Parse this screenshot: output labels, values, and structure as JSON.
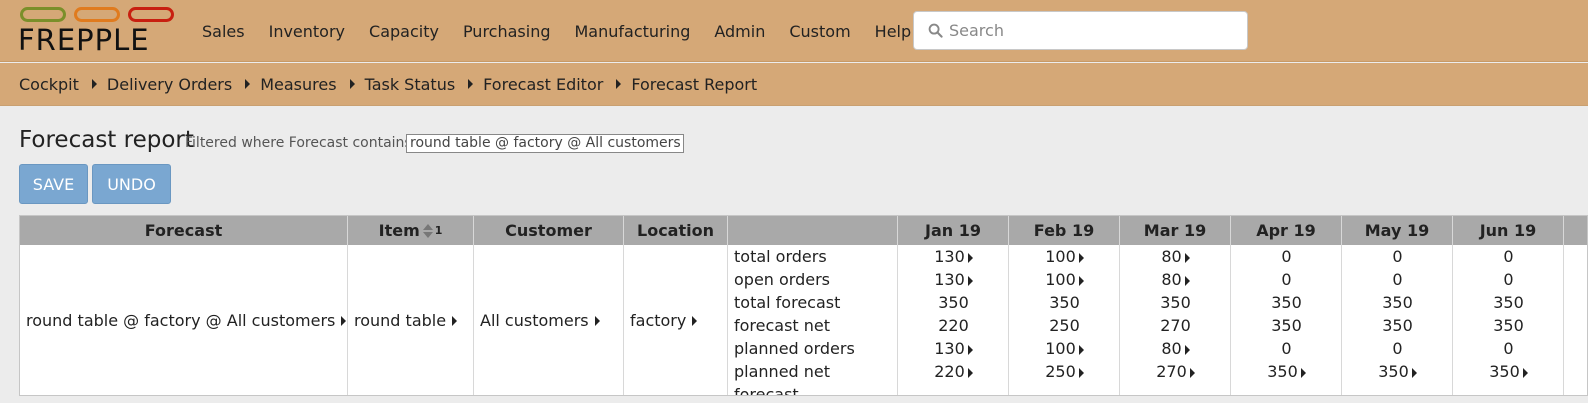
{
  "brand": {
    "logo_text": "FREPPLE"
  },
  "menu": [
    {
      "label": "Sales"
    },
    {
      "label": "Inventory"
    },
    {
      "label": "Capacity"
    },
    {
      "label": "Purchasing"
    },
    {
      "label": "Manufacturing"
    },
    {
      "label": "Admin"
    },
    {
      "label": "Custom"
    },
    {
      "label": "Help"
    }
  ],
  "search": {
    "placeholder": "Search",
    "icon": "search-icon"
  },
  "breadcrumbs": [
    {
      "label": "Cockpit"
    },
    {
      "label": "Delivery Orders"
    },
    {
      "label": "Measures"
    },
    {
      "label": "Task Status"
    },
    {
      "label": "Forecast Editor"
    },
    {
      "label": "Forecast Report"
    }
  ],
  "page": {
    "title": "Forecast report",
    "filter_prefix": "Filtered where Forecast contains",
    "filter_value": "round table @ factory @ All customers"
  },
  "buttons": {
    "save": "SAVE",
    "undo": "UNDO"
  },
  "grid": {
    "headers": {
      "forecast": "Forecast",
      "item": "Item",
      "item_sort_index": "1",
      "customer": "Customer",
      "location": "Location",
      "measure": ""
    },
    "periods": [
      "Jan 19",
      "Feb 19",
      "Mar 19",
      "Apr 19",
      "May 19",
      "Jun 19"
    ],
    "row": {
      "forecast": "round table @ factory @ All customers",
      "item": "round table",
      "customer": "All customers",
      "location": "factory"
    },
    "measures": [
      {
        "label": "total orders",
        "values": [
          "130",
          "100",
          "80",
          "0",
          "0",
          "0"
        ],
        "links": [
          true,
          true,
          true,
          false,
          false,
          false
        ]
      },
      {
        "label": "open orders",
        "values": [
          "130",
          "100",
          "80",
          "0",
          "0",
          "0"
        ],
        "links": [
          true,
          true,
          true,
          false,
          false,
          false
        ]
      },
      {
        "label": "total forecast",
        "values": [
          "350",
          "350",
          "350",
          "350",
          "350",
          "350"
        ],
        "links": [
          false,
          false,
          false,
          false,
          false,
          false
        ]
      },
      {
        "label": "forecast net",
        "values": [
          "220",
          "250",
          "270",
          "350",
          "350",
          "350"
        ],
        "links": [
          false,
          false,
          false,
          false,
          false,
          false
        ]
      },
      {
        "label": "planned orders",
        "values": [
          "130",
          "100",
          "80",
          "0",
          "0",
          "0"
        ],
        "links": [
          true,
          true,
          true,
          false,
          false,
          false
        ]
      },
      {
        "label": "planned net forecast",
        "values": [
          "220",
          "250",
          "270",
          "350",
          "350",
          "350"
        ],
        "links": [
          true,
          true,
          true,
          true,
          true,
          true
        ]
      }
    ]
  },
  "colors": {
    "header_bg": "#d5a877",
    "button": "#7aa7d1",
    "grid_header": "#a9a9a9"
  }
}
